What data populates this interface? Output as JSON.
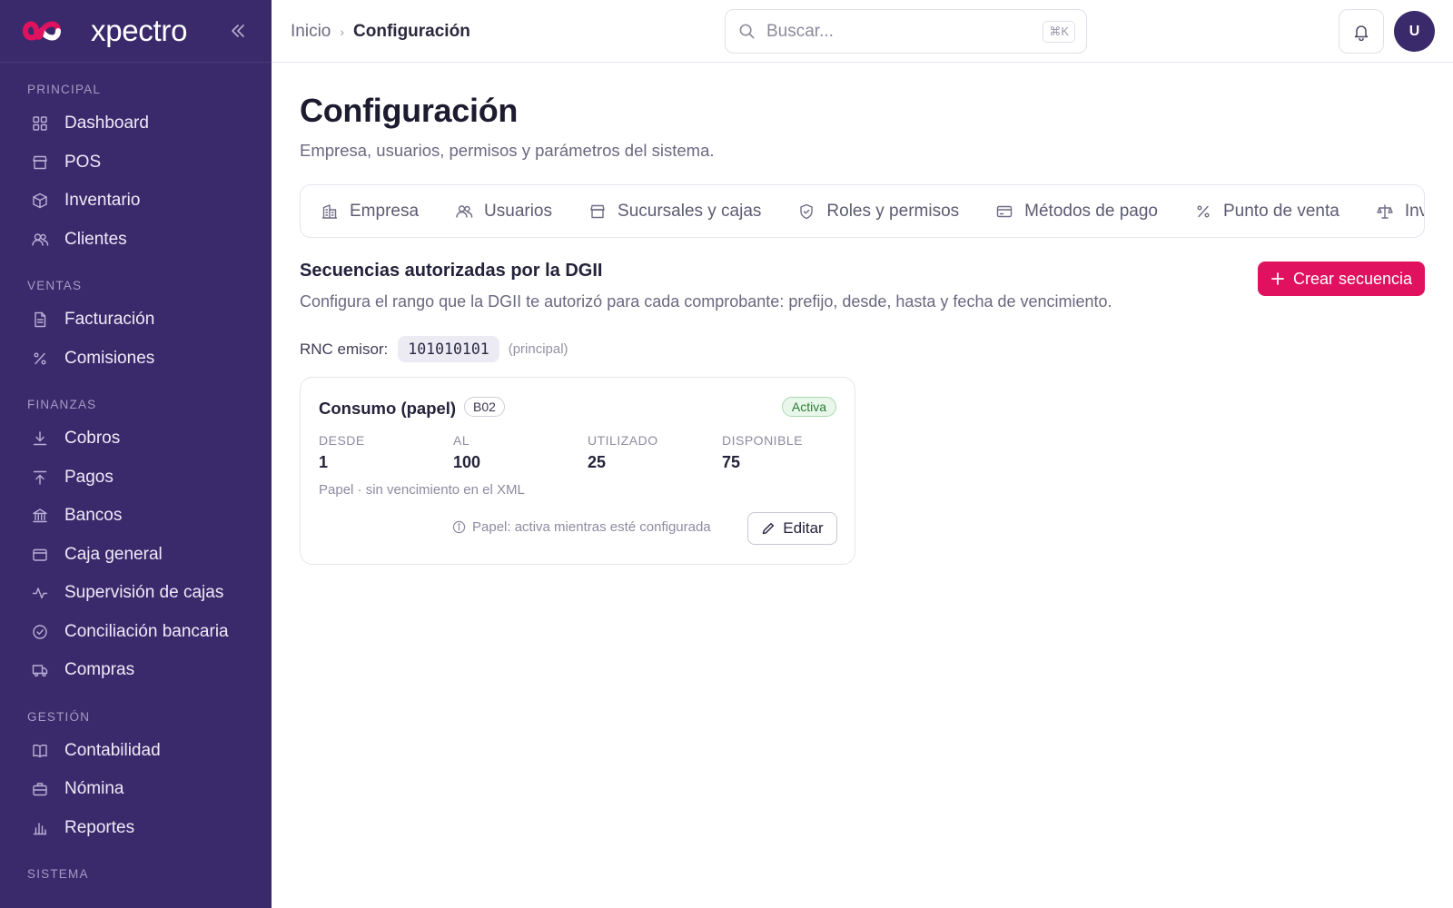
{
  "app": {
    "brand": "xpectro",
    "brand_colors": {
      "sidebar": "#3b2a6b",
      "accent": "#e0115f",
      "logo_pink": "#e0115f",
      "logo_white": "#ffffff"
    }
  },
  "sidebar": {
    "sections": [
      {
        "label": "PRINCIPAL",
        "items": [
          {
            "label": "Dashboard",
            "icon": "grid-icon"
          },
          {
            "label": "POS",
            "icon": "store-icon"
          },
          {
            "label": "Inventario",
            "icon": "box-icon"
          },
          {
            "label": "Clientes",
            "icon": "users-icon"
          }
        ]
      },
      {
        "label": "VENTAS",
        "items": [
          {
            "label": "Facturación",
            "icon": "file-icon"
          },
          {
            "label": "Comisiones",
            "icon": "percent-icon"
          }
        ]
      },
      {
        "label": "FINANZAS",
        "items": [
          {
            "label": "Cobros",
            "icon": "download-icon"
          },
          {
            "label": "Pagos",
            "icon": "upload-icon"
          },
          {
            "label": "Bancos",
            "icon": "bank-icon"
          },
          {
            "label": "Caja general",
            "icon": "wallet-icon"
          },
          {
            "label": "Supervisión de cajas",
            "icon": "activity-icon"
          },
          {
            "label": "Conciliación bancaria",
            "icon": "check-circle-icon"
          },
          {
            "label": "Compras",
            "icon": "truck-icon"
          }
        ]
      },
      {
        "label": "GESTIÓN",
        "items": [
          {
            "label": "Contabilidad",
            "icon": "book-icon"
          },
          {
            "label": "Nómina",
            "icon": "briefcase-icon"
          },
          {
            "label": "Reportes",
            "icon": "bar-chart-icon"
          }
        ]
      },
      {
        "label": "SISTEMA",
        "items": []
      }
    ]
  },
  "topbar": {
    "breadcrumb": {
      "home": "Inicio",
      "current": "Configuración"
    },
    "search": {
      "placeholder": "Buscar...",
      "shortcut": "⌘K"
    },
    "avatar_initial": "U"
  },
  "page": {
    "title": "Configuración",
    "subtitle": "Empresa, usuarios, permisos y parámetros del sistema.",
    "tabs": [
      {
        "label": "Empresa",
        "icon": "building-icon"
      },
      {
        "label": "Usuarios",
        "icon": "users-icon"
      },
      {
        "label": "Sucursales y cajas",
        "icon": "store-icon"
      },
      {
        "label": "Roles y permisos",
        "icon": "shield-icon"
      },
      {
        "label": "Métodos de pago",
        "icon": "credit-card-icon"
      },
      {
        "label": "Punto de venta",
        "icon": "percent-icon"
      },
      {
        "label": "Inventario",
        "icon": "scale-icon"
      }
    ]
  },
  "sequences": {
    "title": "Secuencias autorizadas por la DGII",
    "subtitle": "Configura el rango que la DGII te autorizó para cada comprobante: prefijo, desde, hasta y fecha de vencimiento.",
    "create_label": "Crear secuencia",
    "rnc_label": "RNC emisor:",
    "rnc_value": "101010101",
    "rnc_note": "(principal)",
    "card": {
      "title": "Consumo (papel)",
      "code": "B02",
      "status": "Activa",
      "stats": [
        {
          "label": "DESDE",
          "value": "1"
        },
        {
          "label": "AL",
          "value": "100"
        },
        {
          "label": "UTILIZADO",
          "value": "25"
        },
        {
          "label": "DISPONIBLE",
          "value": "75"
        }
      ],
      "note": "Papel · sin vencimiento en el XML",
      "info": "Papel: activa mientras esté configurada",
      "edit_label": "Editar"
    }
  }
}
